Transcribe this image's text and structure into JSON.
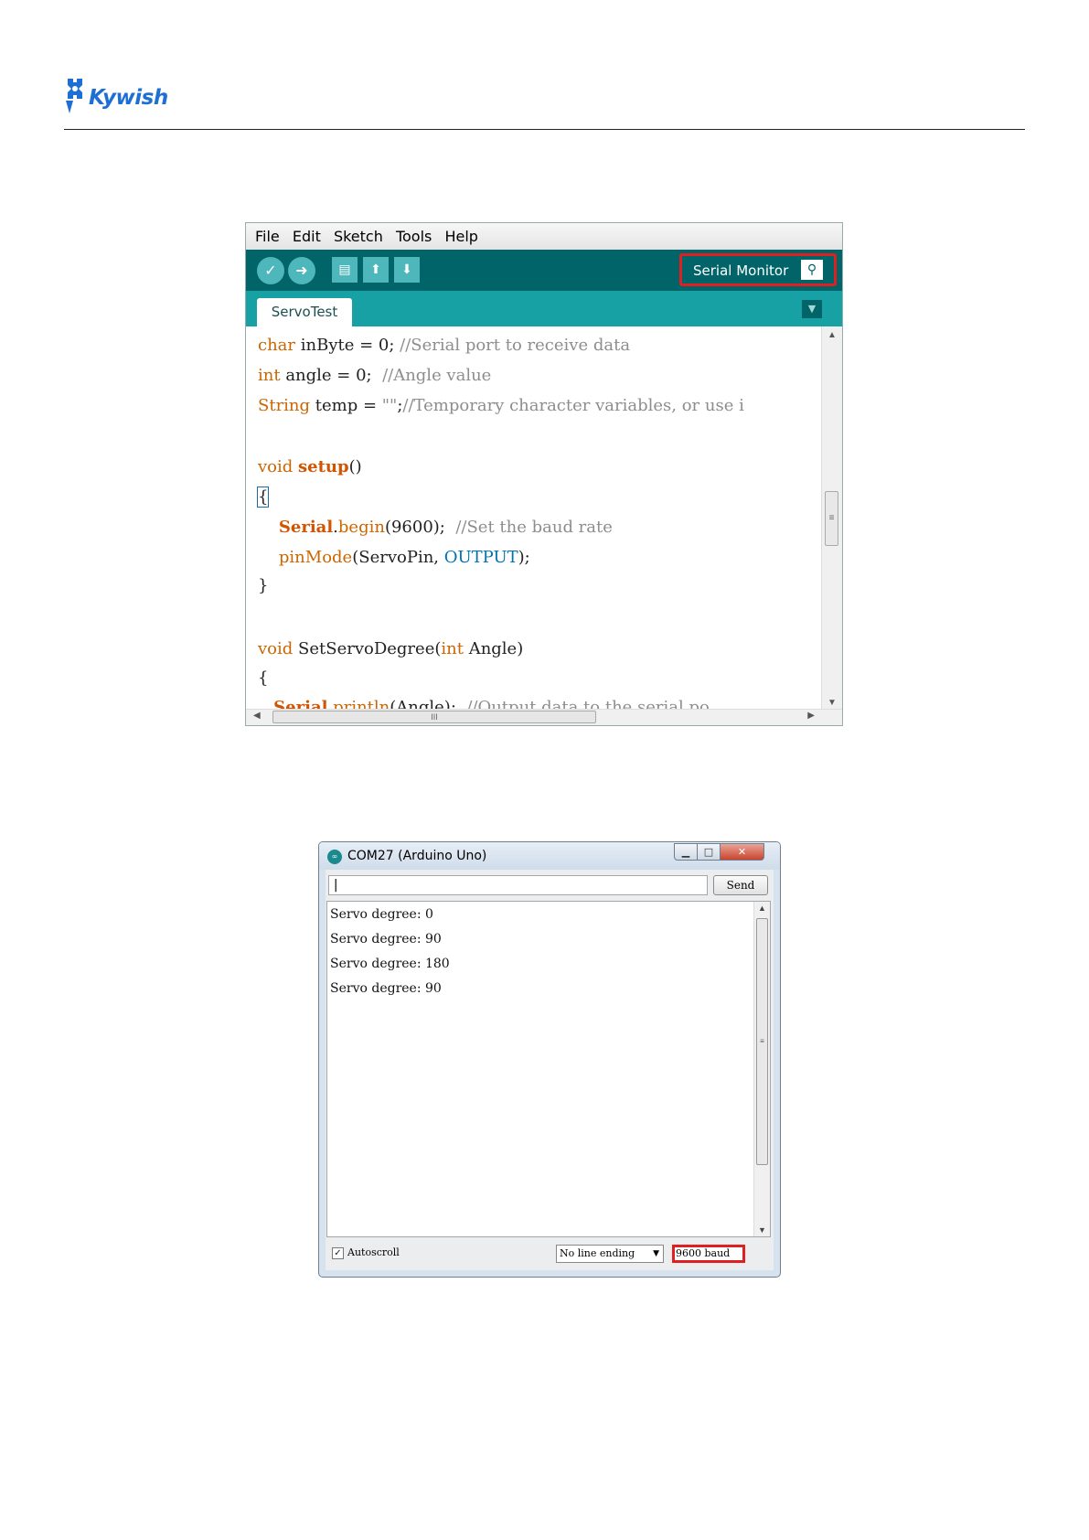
{
  "header": {
    "logo_text": "Kywish",
    "brand_color": "#1d6fd4"
  },
  "ide": {
    "menu": [
      "File",
      "Edit",
      "Sketch",
      "Tools",
      "Help"
    ],
    "toolbar_icons": [
      "verify-icon",
      "upload-icon",
      "new-icon",
      "open-icon",
      "save-icon",
      "serial-monitor-icon"
    ],
    "serial_monitor_label": "Serial Monitor",
    "tab_name": "ServoTest",
    "colors": {
      "toolbar": "#006468",
      "tabbar": "#17a1a5",
      "highlight": "#e02020"
    }
  },
  "serial_monitor": {
    "title": "COM27 (Arduino Uno)",
    "input_value": "|",
    "send_label": "Send",
    "output_lines": [
      "Servo degree: 0",
      "Servo degree: 90",
      "Servo degree: 180",
      "Servo degree: 90"
    ],
    "autoscroll_label": "Autoscroll",
    "autoscroll_checked": true,
    "line_ending": "No line ending",
    "baud": "9600 baud"
  }
}
